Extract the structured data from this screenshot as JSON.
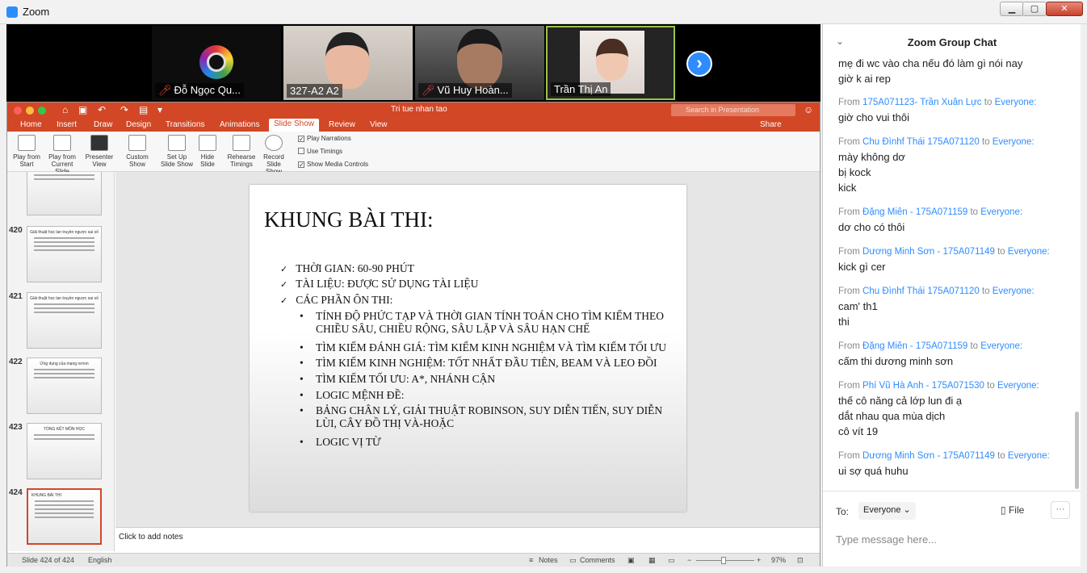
{
  "window": {
    "title": "Zoom",
    "min": "▁",
    "max": "▢",
    "close": "✕"
  },
  "participants": [
    {
      "name": "Đỗ Ngọc Qu...",
      "muted": true
    },
    {
      "name": "327-A2 A2",
      "muted": false
    },
    {
      "name": "Vũ Huy Hoàn...",
      "muted": true
    },
    {
      "name": "Trần Thị An",
      "muted": false
    }
  ],
  "next_icon": "chevron-right-icon",
  "ppt": {
    "doc_title": "Tri tue nhan tao",
    "search_placeholder": "Search in Presentation",
    "share": "Share",
    "tabs": [
      "Home",
      "Insert",
      "Draw",
      "Design",
      "Transitions",
      "Animations",
      "Slide Show",
      "Review",
      "View"
    ],
    "selected_tab": "Slide Show",
    "ribbon": {
      "play_from_start": "Play from Start",
      "play_from_current": "Play from Current Slide",
      "presenter_view": "Presenter View",
      "custom_show": "Custom Show",
      "set_up_slide_show": "Set Up Slide Show",
      "hide_slide": "Hide Slide",
      "rehearse_timings": "Rehearse Timings",
      "record_slide_show": "Record Slide Show",
      "play_narrations": "Play Narrations",
      "use_timings": "Use Timings",
      "show_media_controls": "Show Media Controls"
    },
    "thumbnails": [
      {
        "num": "",
        "title": ""
      },
      {
        "num": "420",
        "title": "Giải thuật học lan truyền ngược sai số"
      },
      {
        "num": "421",
        "title": "Giải thuật học lan truyền ngược sai số"
      },
      {
        "num": "422",
        "title": "Ứng dụng của mạng nơron"
      },
      {
        "num": "423",
        "title": "TỔNG KẾT MÔN HỌC"
      },
      {
        "num": "424",
        "title": "KHUNG BÀI THI"
      }
    ],
    "slide": {
      "title": "KHUNG BÀI THI:",
      "l1_a": "THỜI GIAN: 60-90 PHÚT",
      "l1_b": "TÀI LIỆU: ĐƯỢC SỬ DỤNG TÀI LIỆU",
      "l1_c": "CÁC PHẦN ÔN THI:",
      "l2_a": "TÍNH ĐỘ PHỨC TẠP VÀ THỜI GIAN TÍNH TOÁN CHO TÌM KIẾM THEO CHIỀU SÂU, CHIỀU RỘNG, SÂU LẶP VÀ SÂU HẠN CHẾ",
      "l2_b": "TÌM KIẾM ĐÁNH GIÁ: TÌM KIẾM KINH NGHIỆM VÀ TÌM KIẾM TỐI ƯU",
      "l2_c": "TÌM KIẾM KINH NGHIỆM: TỐT NHẤT ĐẦU TIÊN, BEAM VÀ LEO ĐỒI",
      "l2_d": "TÌM KIẾM TỐI ƯU: A*, NHÁNH CẬN",
      "l2_e": "LOGIC MỆNH ĐỀ:",
      "l2_f": "BẢNG CHÂN LÝ, GIẢI THUẬT ROBINSON, SUY DIỄN TIẾN, SUY DIỄN LÙI, CÂY ĐỒ THỊ VÀ-HOẶC",
      "l2_g": "LOGIC VỊ TỪ"
    },
    "notes_placeholder": "Click to add notes",
    "status": {
      "slide_of": "Slide 424 of 424",
      "language": "English",
      "notes": "Notes",
      "comments": "Comments",
      "zoom": "97%"
    }
  },
  "chat": {
    "title": "Zoom Group Chat",
    "messages": [
      {
        "from": "",
        "to": "",
        "lines": [
          "mẹ đi wc vào cha nếu đó làm gì nói nay",
          "giờ k ai rep"
        ]
      },
      {
        "from": "175A071123- Trần Xuân Lực",
        "to": "Everyone:",
        "lines": [
          "giờ cho vui thôi"
        ]
      },
      {
        "from": "Chu Đìnhf Thái 175A071120",
        "to": "Everyone:",
        "lines": [
          "mày không dơ",
          "bị kock",
          "kick"
        ]
      },
      {
        "from": "Đặng Miên - 175A071159",
        "to": "Everyone:",
        "lines": [
          "dơ cho có thôi"
        ]
      },
      {
        "from": "Dương Minh Sơn - 175A071149",
        "to": "Everyone:",
        "lines": [
          "kick gì cer"
        ]
      },
      {
        "from": "Chu Đìnhf Thái 175A071120",
        "to": "Everyone:",
        "lines": [
          "cam' th1",
          "thi"
        ]
      },
      {
        "from": "Đặng Miên - 175A071159",
        "to": "Everyone:",
        "lines": [
          "cấm thi dương minh sơn"
        ]
      },
      {
        "from": "Phí Vũ Hà Anh - 175A071530",
        "to": "Everyone:",
        "lines": [
          "thế cô năng cả lớp lun đi ạ",
          "dắt nhau qua mùa dịch",
          "cô vít 19"
        ]
      },
      {
        "from": "Dương Minh Sơn - 175A071149",
        "to": "Everyone:",
        "lines": [
          "ui sợ quá huhu"
        ]
      }
    ],
    "from_word": "From",
    "to_word": "to",
    "to_label": "To:",
    "to_value": "Everyone",
    "file_label": "File",
    "more": "···",
    "input_placeholder": "Type message here..."
  }
}
